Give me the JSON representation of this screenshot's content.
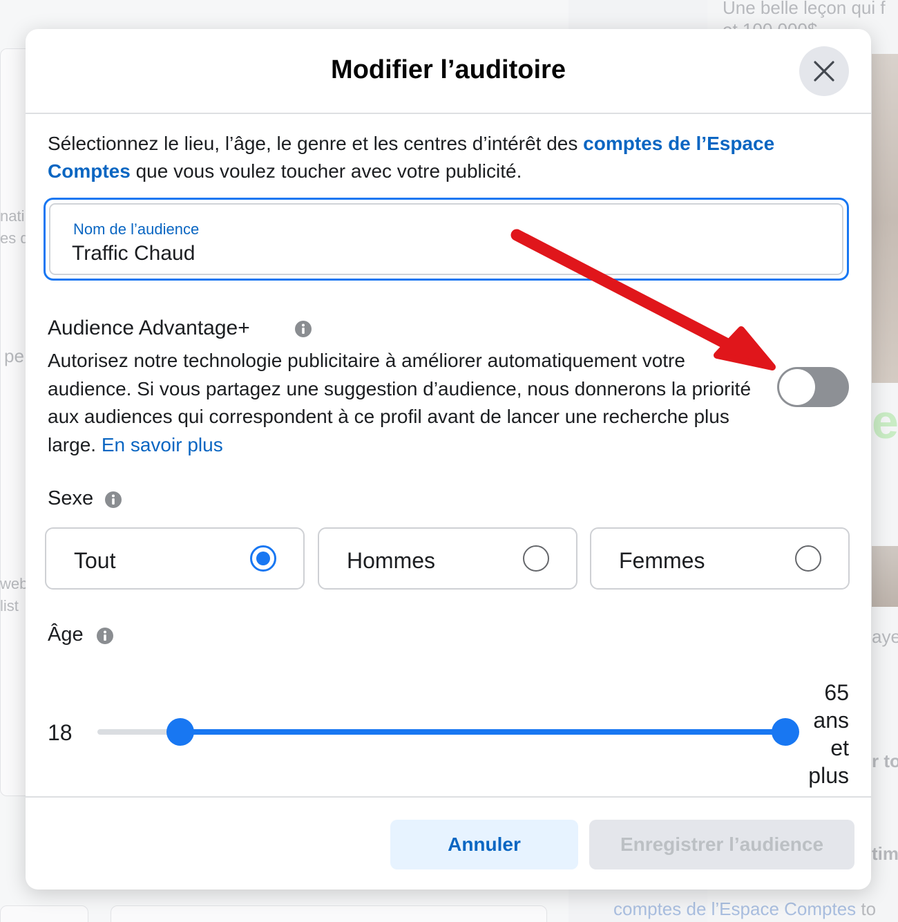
{
  "background": {
    "top_right_text_1": "Une belle leçon qui f",
    "top_right_text_2": "et 100 000$",
    "left_fragment_1": "nati",
    "left_fragment_2": "es d",
    "left_fragment_3": "pe",
    "left_fragment_4": "web",
    "left_fragment_5": "list",
    "right_fragment_1": "aye",
    "right_fragment_2": "r to",
    "right_fragment_3": "tim",
    "bottom_link": "comptes de l’Espace Comptes",
    "bottom_link_suffix": "to"
  },
  "dialog": {
    "title": "Modifier l’auditoire",
    "close_icon": "close-icon",
    "intro": {
      "before": "Sélectionnez le lieu, l’âge, le genre et les centres d’intérêt des ",
      "link": "comptes de l’Espace Comptes",
      "after": " que vous voulez toucher avec votre publicité."
    },
    "audience_name": {
      "label": "Nom de l’audience",
      "value": "Traffic Chaud"
    },
    "advantage": {
      "title": "Audience Advantage+",
      "description": "Autorisez notre technologie publicitaire à améliorer automatiquement votre audience. Si vous partagez une suggestion d’audience, nous donnerons la priorité aux audiences qui correspondent à ce profil avant de lancer une recherche plus large.",
      "learn_more": "En savoir plus",
      "toggle_on": false
    },
    "gender": {
      "title": "Sexe",
      "options": [
        {
          "label": "Tout",
          "selected": true
        },
        {
          "label": "Hommes",
          "selected": false
        },
        {
          "label": "Femmes",
          "selected": false
        }
      ]
    },
    "age": {
      "title": "Âge",
      "min": "18",
      "max_lines": [
        "65",
        "ans",
        "et",
        "plus"
      ],
      "min_fraction": 0.12,
      "max_fraction": 1.0
    },
    "footer": {
      "cancel": "Annuler",
      "save": "Enregistrer l’audience"
    }
  },
  "colors": {
    "accent": "#1877f2",
    "link": "#0a66c2",
    "annotation_arrow": "#e0161b"
  }
}
